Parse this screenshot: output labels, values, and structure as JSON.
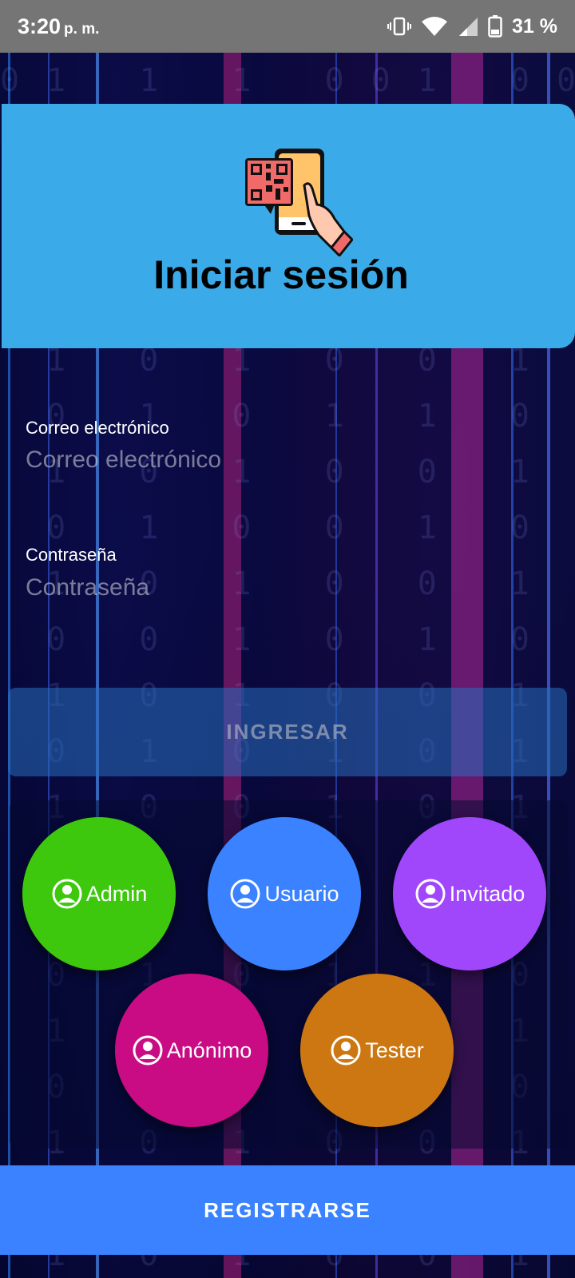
{
  "status_bar": {
    "time": "3:20",
    "ampm": "p. m.",
    "battery": "31 %"
  },
  "header": {
    "title": "Iniciar sesión",
    "logo_icon": "qr-phone-scan-icon",
    "background": "#3aabe8"
  },
  "form": {
    "email": {
      "label": "Correo electrónico",
      "placeholder": "Correo electrónico",
      "value": ""
    },
    "password": {
      "label": "Contraseña",
      "placeholder": "Contraseña",
      "value": ""
    },
    "submit_label": "INGRESAR"
  },
  "quick_login": {
    "roles": [
      {
        "label": "Admin",
        "color": "#3dc80e",
        "icon": "user-circle-icon"
      },
      {
        "label": "Usuario",
        "color": "#3a82ff",
        "icon": "user-circle-icon"
      },
      {
        "label": "Invitado",
        "color": "#a046fb",
        "icon": "user-circle-icon"
      },
      {
        "label": "Anónimo",
        "color": "#c90c84",
        "icon": "user-circle-icon"
      },
      {
        "label": "Tester",
        "color": "#cd7713",
        "icon": "user-circle-icon"
      }
    ]
  },
  "register_label": "REGISTRARSE"
}
